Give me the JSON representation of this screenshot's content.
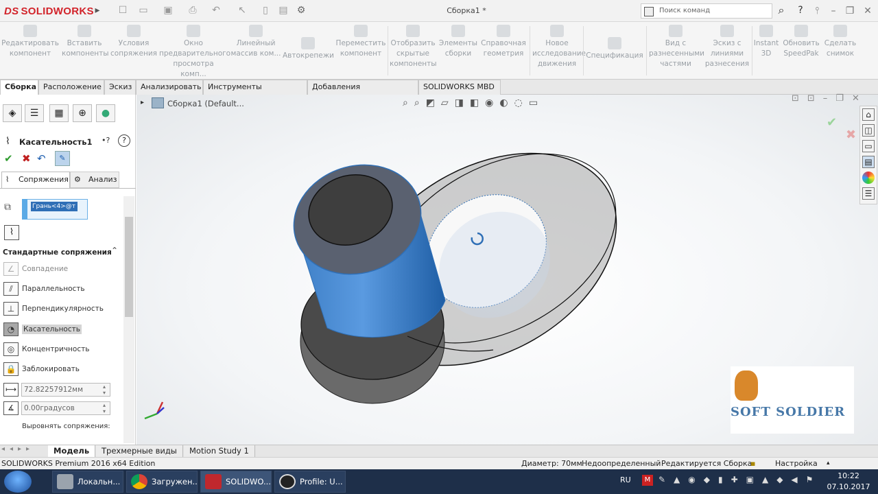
{
  "titlebar": {
    "logo_ds": "DS",
    "logo_name": "SOLIDWORKS",
    "document_title": "Сборка1 *",
    "search_placeholder": "Поиск команд",
    "help": "?"
  },
  "ribbon": {
    "buttons": [
      {
        "label": "Редактировать компонент"
      },
      {
        "label": "Вставить компоненты"
      },
      {
        "label": "Условия сопряжения"
      },
      {
        "label": "Окно предварительного просмотра комп..."
      },
      {
        "label": "Линейный массив ком..."
      },
      {
        "label": "Автокрепежи"
      },
      {
        "label": "Переместить компонент"
      },
      {
        "label": "Отобразить скрытые компоненты"
      },
      {
        "label": "Элементы сборки"
      },
      {
        "label": "Справочная геометрия"
      },
      {
        "label": "Новое исследование движения"
      },
      {
        "label": "Спецификация"
      },
      {
        "label": "Вид с разнесенными частями"
      },
      {
        "label": "Эскиз с линиями разнесения"
      },
      {
        "label": "Instant 3D"
      },
      {
        "label": "Обновить SpeedPak"
      },
      {
        "label": "Сделать снимок"
      }
    ]
  },
  "tabs": [
    {
      "label": "Сборка",
      "active": true
    },
    {
      "label": "Расположение"
    },
    {
      "label": "Эскиз"
    },
    {
      "label": "Анализировать"
    },
    {
      "label": "Инструменты отрисовки"
    },
    {
      "label": "Добавления SOLIDWORKS"
    },
    {
      "label": "SOLIDWORKS MBD"
    }
  ],
  "property_manager": {
    "title": "Касательность1",
    "subtabs": {
      "mates": "Сопряжения",
      "analysis": "Анализ"
    },
    "selection": "Грань<4>@т",
    "section_title": "Стандартные сопряжения",
    "mates": [
      {
        "label": "Совпадение",
        "icon": "coincident-icon",
        "disabled": true
      },
      {
        "label": "Параллельность",
        "icon": "parallel-icon"
      },
      {
        "label": "Перпендикулярность",
        "icon": "perpendicular-icon"
      },
      {
        "label": "Касательность",
        "icon": "tangent-icon",
        "selected": true
      },
      {
        "label": "Концентричность",
        "icon": "concentric-icon"
      },
      {
        "label": "Заблокировать",
        "icon": "lock-icon"
      }
    ],
    "distance_value": "72.82257912мм",
    "angle_value": "0.00градусов",
    "align_label": "Выровнять сопряжения:"
  },
  "viewport": {
    "tree_root": "Сборка1  (Default..."
  },
  "watermark": "SOFT SOLDIER",
  "bottom_tabs": [
    {
      "label": "Модель",
      "active": true
    },
    {
      "label": "Трехмерные виды"
    },
    {
      "label": "Motion Study 1"
    }
  ],
  "statusbar": {
    "edition": "SOLIDWORKS Premium 2016 x64 Edition",
    "diameter": "Диаметр: 70мм",
    "state": "Недоопределенный",
    "editing": "Редактируется Сборка",
    "settings": "Настройка"
  },
  "taskbar": {
    "items": [
      {
        "label": "Локальн...",
        "color": "#9aa3ad"
      },
      {
        "label": "Загружен...",
        "color": "#e9c13a"
      },
      {
        "label": "SOLIDWO...",
        "color": "#c0282d"
      },
      {
        "label": "Profile: U...",
        "color": "#222222"
      }
    ],
    "lang": "RU",
    "time": "10:22",
    "date": "07.10.2017"
  },
  "colors": {
    "accent_blue": "#2f6fb6",
    "sw_red": "#d2232a"
  }
}
